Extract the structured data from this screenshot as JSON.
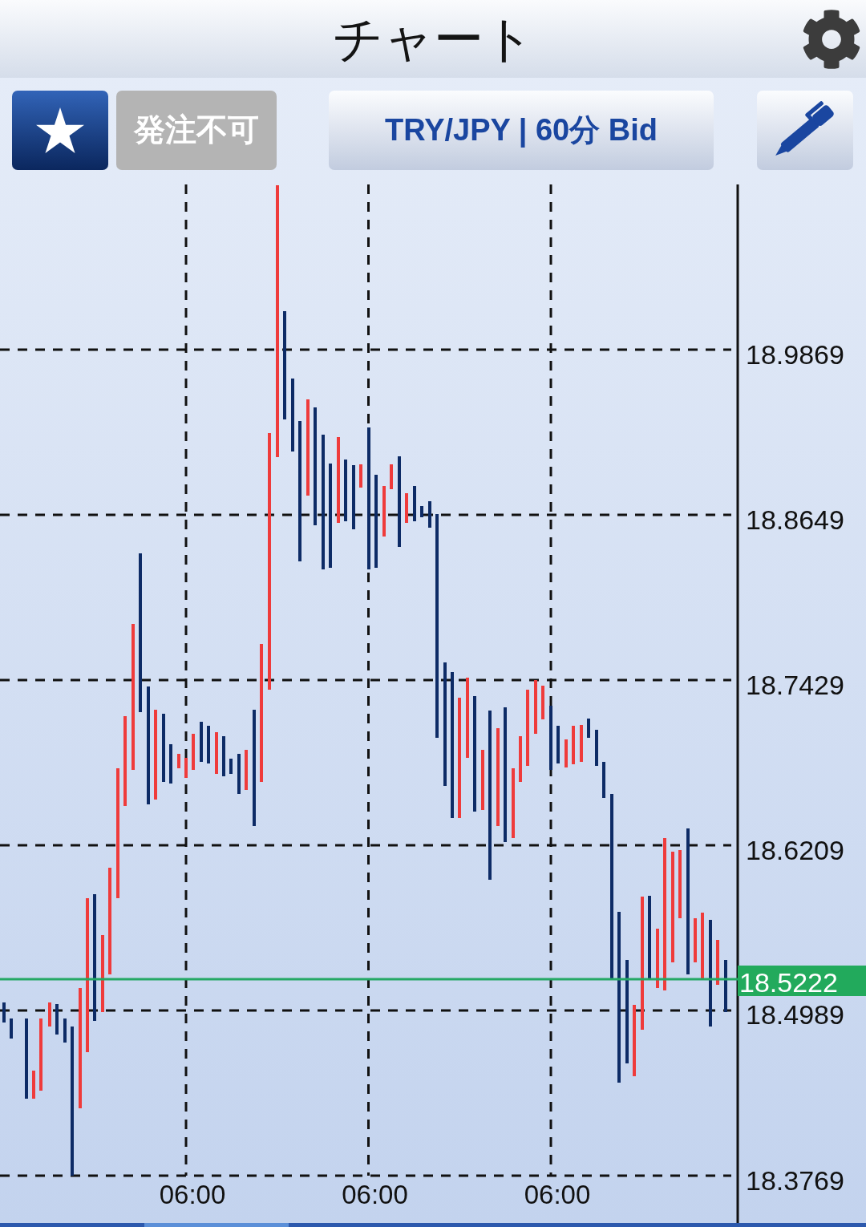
{
  "header": {
    "title": "チャート"
  },
  "toolbar": {
    "order_button": {
      "label": "発注不可",
      "disabled": true
    },
    "symbol_button": {
      "label": "TRY/JPY | 60分 Bid"
    }
  },
  "chart": {
    "price_labels": [
      "18.9869",
      "18.8649",
      "18.7429",
      "18.6209",
      "18.4989",
      "18.3769"
    ],
    "time_labels": [
      "06:00",
      "06:00",
      "06:00"
    ],
    "current_price": "18.5222"
  }
}
